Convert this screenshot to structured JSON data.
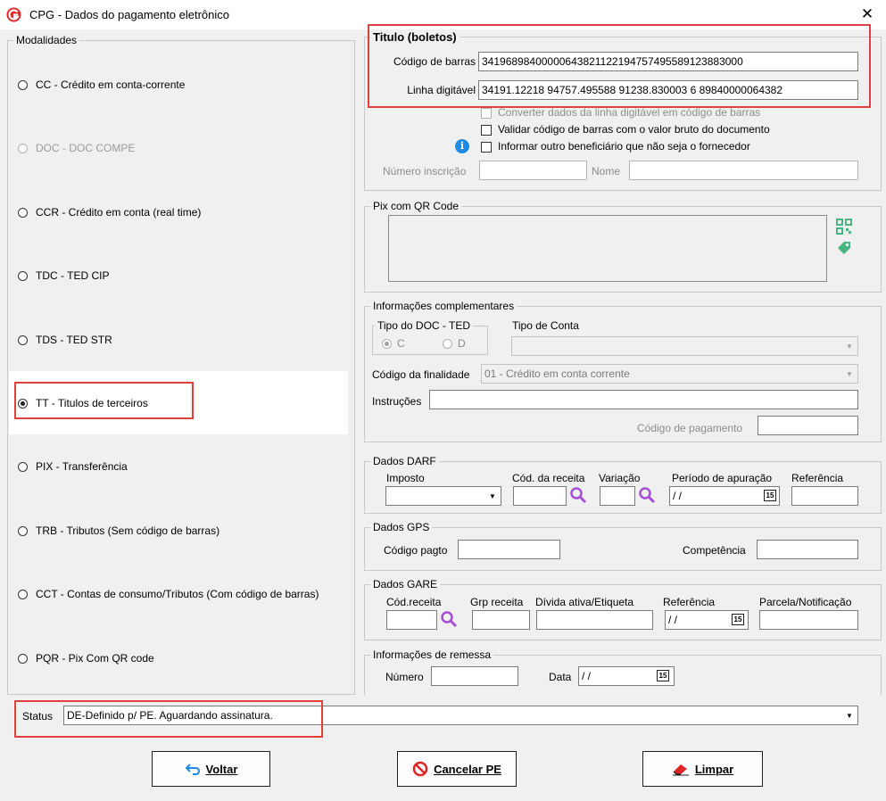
{
  "window": {
    "title": "CPG - Dados do pagamento eletrônico",
    "close_symbol": "✕"
  },
  "modalidades": {
    "legend": "Modalidades",
    "items": [
      {
        "label": "CC  - Crédito em conta-corrente",
        "checked": false,
        "enabled": true
      },
      {
        "label": "DOC - DOC COMPE",
        "checked": false,
        "enabled": false
      },
      {
        "label": "CCR - Crédito em conta (real time)",
        "checked": false,
        "enabled": true
      },
      {
        "label": "TDC - TED CIP",
        "checked": false,
        "enabled": true
      },
      {
        "label": "TDS - TED STR",
        "checked": false,
        "enabled": true
      },
      {
        "label": "TT  - Titulos de terceiros",
        "checked": true,
        "enabled": true
      },
      {
        "label": "PIX - Transferência",
        "checked": false,
        "enabled": true
      },
      {
        "label": "TRB - Tributos (Sem código de barras)",
        "checked": false,
        "enabled": true
      },
      {
        "label": "CCT - Contas de consumo/Tributos (Com código de barras)",
        "checked": false,
        "enabled": true
      },
      {
        "label": "PQR - Pix Com QR code",
        "checked": false,
        "enabled": true
      }
    ]
  },
  "titulo": {
    "legend": "Titulo (boletos)",
    "codigo_barras_label": "Código de barras",
    "codigo_barras_value": "34196898400000643821122194757495589123883000",
    "linha_digitavel_label": "Linha digitável",
    "linha_digitavel_value": "34191.12218 94757.495588 91238.830003 6 89840000064382",
    "chk_converter": "Converter dados da linha digitável em código de barras",
    "chk_validar": "Validar código de barras com o valor bruto do documento",
    "chk_informar": "Informar outro beneficiário que não seja o fornecedor",
    "numero_inscricao_label": "Número inscrição",
    "nome_label": "Nome",
    "info_icon": "i"
  },
  "pix_qr": {
    "legend": "Pix com QR Code"
  },
  "complementares": {
    "legend": "Informações complementares",
    "tipo_doc_ted_legend": "Tipo do DOC - TED",
    "radio_c": "C",
    "radio_d": "D",
    "tipo_conta_label": "Tipo de Conta",
    "codigo_finalidade_label": "Código da finalidade",
    "codigo_finalidade_value": "01 - Crédito em conta corrente",
    "instrucoes_label": "Instruções",
    "codigo_pagamento_label": "Código de pagamento"
  },
  "darf": {
    "legend": "Dados DARF",
    "imposto_label": "Imposto",
    "cod_receita_label": "Cód. da receita",
    "variacao_label": "Variação",
    "periodo_label": "Período de apuração",
    "periodo_value": " / /",
    "referencia_label": "Referência",
    "calendar_text": "15"
  },
  "gps": {
    "legend": "Dados GPS",
    "codigo_pagto_label": "Código pagto",
    "competencia_label": "Competência"
  },
  "gare": {
    "legend": "Dados GARE",
    "cod_receita_label": "Cód.receita",
    "grp_receita_label": "Grp receita",
    "divida_label": "Dívida ativa/Etiqueta",
    "referencia_label": "Referência",
    "referencia_value": " / /",
    "parcela_label": "Parcela/Notificação",
    "calendar_text": "15"
  },
  "remessa": {
    "legend": "Informações de remessa",
    "numero_label": "Número",
    "data_label": "Data",
    "data_value": " / /",
    "calendar_text": "15"
  },
  "status": {
    "label": "Status",
    "value": "DE-Definido p/ PE. Aguardando assinatura."
  },
  "buttons": {
    "voltar": "Voltar",
    "cancelar": "Cancelar PE",
    "limpar": "Limpar"
  },
  "colors": {
    "highlight": "#e04040",
    "accent": "#1f8ae6",
    "lookup": "#a64fd6",
    "qr": "#49b583"
  }
}
